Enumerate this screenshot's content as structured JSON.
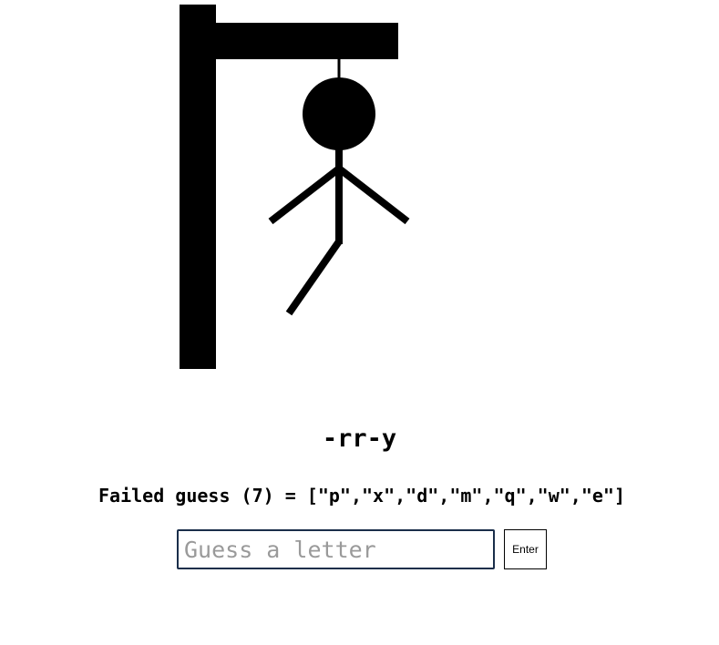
{
  "game": {
    "word_display": "-rr-y",
    "failed_label": "Failed guess (7) = [\"p\",\"x\",\"d\",\"m\",\"q\",\"w\",\"e\"]",
    "failed_count": 7,
    "failed_letters": [
      "p",
      "x",
      "d",
      "m",
      "q",
      "w",
      "e"
    ],
    "drawn_parts": [
      "post",
      "beam",
      "rope",
      "head",
      "body",
      "left-arm",
      "right-arm",
      "left-leg"
    ]
  },
  "input": {
    "placeholder": "Guess a letter",
    "value": ""
  },
  "enter_button": {
    "label": "Enter"
  },
  "colors": {
    "ink": "#000000",
    "background": "#ffffff",
    "input_border": "#1a2e4a",
    "placeholder": "#9a9a9a"
  }
}
